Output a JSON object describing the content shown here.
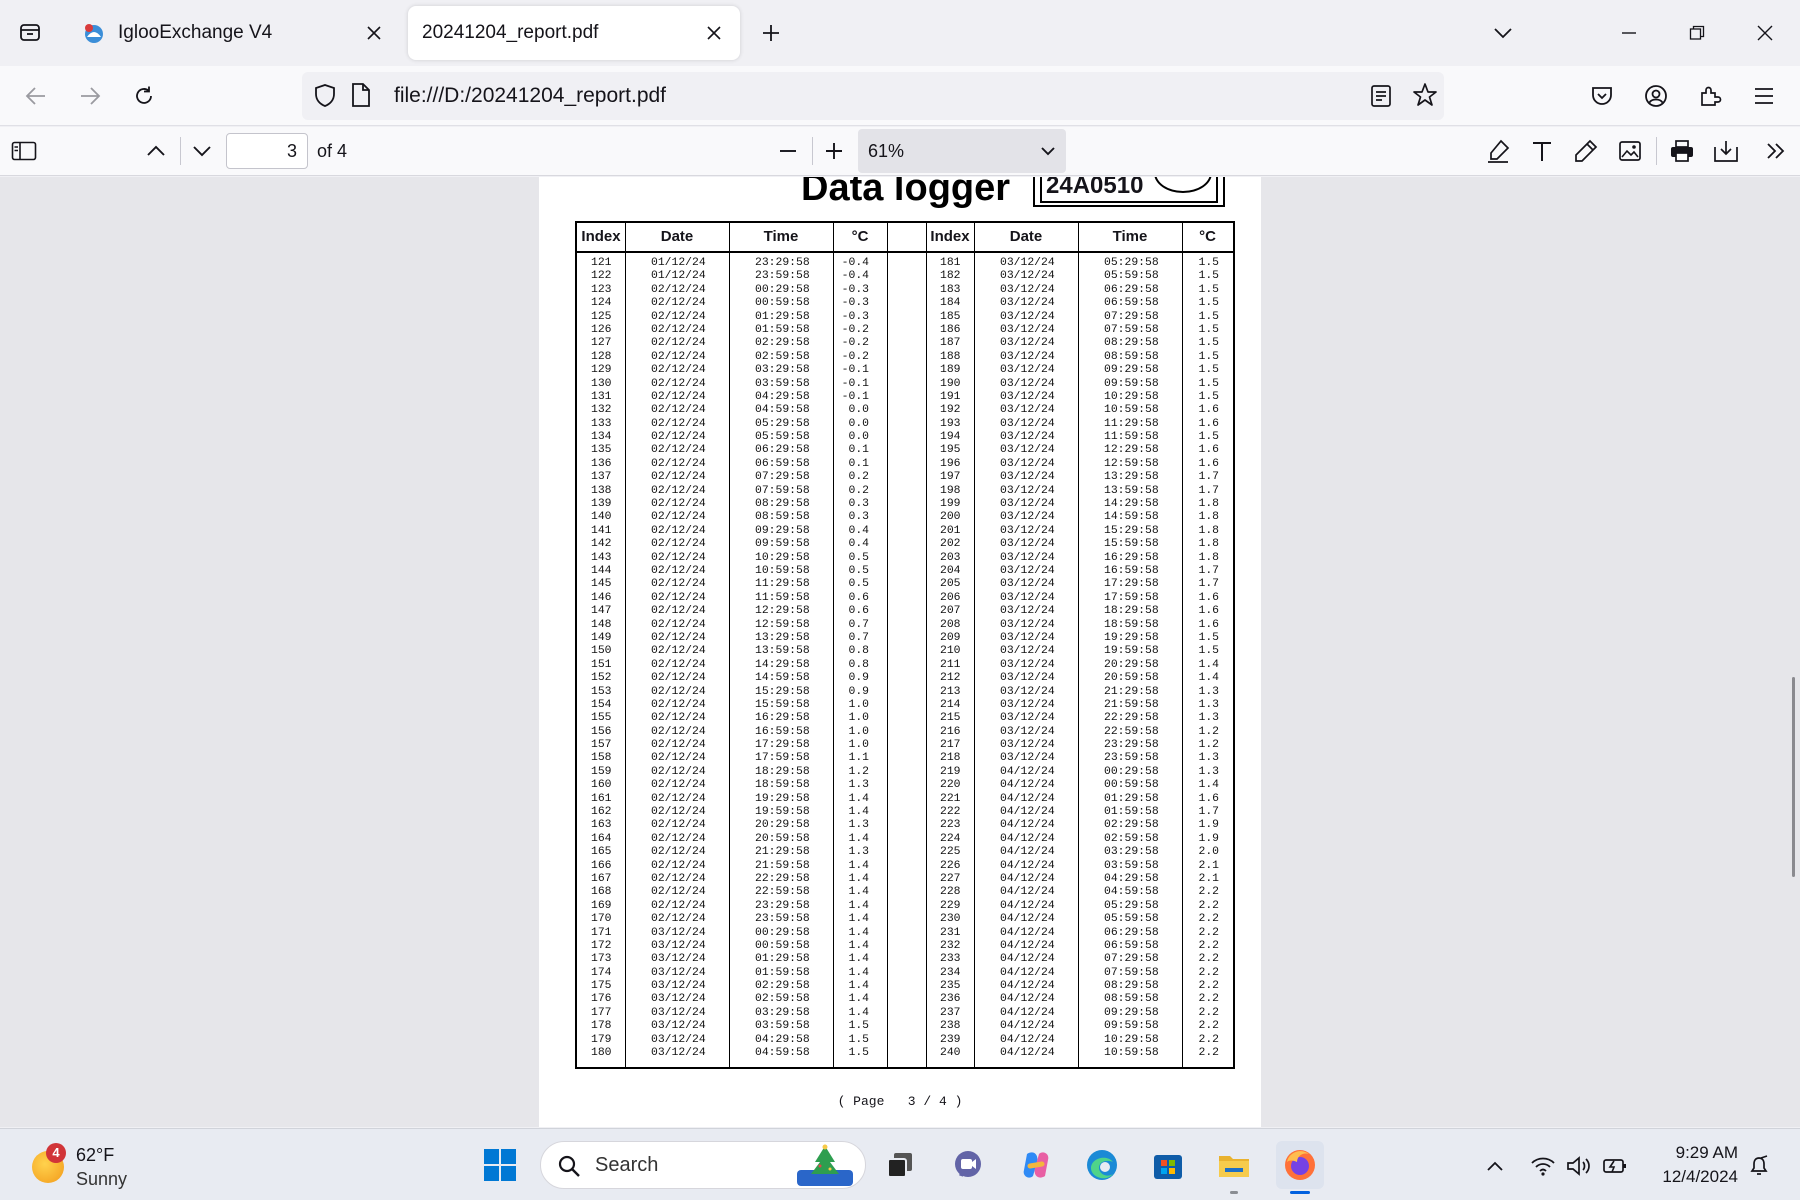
{
  "browser": {
    "tabs": [
      {
        "label": "IglooExchange V4",
        "active": false
      },
      {
        "label": "20241204_report.pdf",
        "active": true
      }
    ],
    "url": "file:///D:/20241204_report.pdf"
  },
  "pdf_toolbar": {
    "page_current": "3",
    "page_count_label": "of 4",
    "zoom": "61%"
  },
  "document": {
    "title": "Data logger",
    "serial": "24A0510",
    "headers": [
      "Index",
      "Date",
      "Time",
      "°C",
      "Index",
      "Date",
      "Time",
      "°C"
    ],
    "left": {
      "index": [
        "121",
        "122",
        "123",
        "124",
        "125",
        "126",
        "127",
        "128",
        "129",
        "130",
        "131",
        "132",
        "133",
        "134",
        "135",
        "136",
        "137",
        "138",
        "139",
        "140",
        "141",
        "142",
        "143",
        "144",
        "145",
        "146",
        "147",
        "148",
        "149",
        "150",
        "151",
        "152",
        "153",
        "154",
        "155",
        "156",
        "157",
        "158",
        "159",
        "160",
        "161",
        "162",
        "163",
        "164",
        "165",
        "166",
        "167",
        "168",
        "169",
        "170",
        "171",
        "172",
        "173",
        "174",
        "175",
        "176",
        "177",
        "178",
        "179",
        "180"
      ],
      "date": [
        "01/12/24",
        "01/12/24",
        "02/12/24",
        "02/12/24",
        "02/12/24",
        "02/12/24",
        "02/12/24",
        "02/12/24",
        "02/12/24",
        "02/12/24",
        "02/12/24",
        "02/12/24",
        "02/12/24",
        "02/12/24",
        "02/12/24",
        "02/12/24",
        "02/12/24",
        "02/12/24",
        "02/12/24",
        "02/12/24",
        "02/12/24",
        "02/12/24",
        "02/12/24",
        "02/12/24",
        "02/12/24",
        "02/12/24",
        "02/12/24",
        "02/12/24",
        "02/12/24",
        "02/12/24",
        "02/12/24",
        "02/12/24",
        "02/12/24",
        "02/12/24",
        "02/12/24",
        "02/12/24",
        "02/12/24",
        "02/12/24",
        "02/12/24",
        "02/12/24",
        "02/12/24",
        "02/12/24",
        "02/12/24",
        "02/12/24",
        "02/12/24",
        "02/12/24",
        "02/12/24",
        "02/12/24",
        "02/12/24",
        "02/12/24",
        "03/12/24",
        "03/12/24",
        "03/12/24",
        "03/12/24",
        "03/12/24",
        "03/12/24",
        "03/12/24",
        "03/12/24",
        "03/12/24",
        "03/12/24"
      ],
      "time": [
        "23:29:58",
        "23:59:58",
        "00:29:58",
        "00:59:58",
        "01:29:58",
        "01:59:58",
        "02:29:58",
        "02:59:58",
        "03:29:58",
        "03:59:58",
        "04:29:58",
        "04:59:58",
        "05:29:58",
        "05:59:58",
        "06:29:58",
        "06:59:58",
        "07:29:58",
        "07:59:58",
        "08:29:58",
        "08:59:58",
        "09:29:58",
        "09:59:58",
        "10:29:58",
        "10:59:58",
        "11:29:58",
        "11:59:58",
        "12:29:58",
        "12:59:58",
        "13:29:58",
        "13:59:58",
        "14:29:58",
        "14:59:58",
        "15:29:58",
        "15:59:58",
        "16:29:58",
        "16:59:58",
        "17:29:58",
        "17:59:58",
        "18:29:58",
        "18:59:58",
        "19:29:58",
        "19:59:58",
        "20:29:58",
        "20:59:58",
        "21:29:58",
        "21:59:58",
        "22:29:58",
        "22:59:58",
        "23:29:58",
        "23:59:58",
        "00:29:58",
        "00:59:58",
        "01:29:58",
        "01:59:58",
        "02:29:58",
        "02:59:58",
        "03:29:58",
        "03:59:58",
        "04:29:58",
        "04:59:58"
      ],
      "temp": [
        "-0.4",
        "-0.4",
        "-0.3",
        "-0.3",
        "-0.3",
        "-0.2",
        "-0.2",
        "-0.2",
        "-0.1",
        "-0.1",
        "-0.1",
        "0.0",
        "0.0",
        "0.0",
        "0.1",
        "0.1",
        "0.2",
        "0.2",
        "0.3",
        "0.3",
        "0.4",
        "0.4",
        "0.5",
        "0.5",
        "0.5",
        "0.6",
        "0.6",
        "0.7",
        "0.7",
        "0.8",
        "0.8",
        "0.9",
        "0.9",
        "1.0",
        "1.0",
        "1.0",
        "1.0",
        "1.1",
        "1.2",
        "1.3",
        "1.4",
        "1.4",
        "1.3",
        "1.4",
        "1.3",
        "1.4",
        "1.4",
        "1.4",
        "1.4",
        "1.4",
        "1.4",
        "1.4",
        "1.4",
        "1.4",
        "1.4",
        "1.4",
        "1.4",
        "1.5",
        "1.5",
        "1.5"
      ]
    },
    "right": {
      "index": [
        "181",
        "182",
        "183",
        "184",
        "185",
        "186",
        "187",
        "188",
        "189",
        "190",
        "191",
        "192",
        "193",
        "194",
        "195",
        "196",
        "197",
        "198",
        "199",
        "200",
        "201",
        "202",
        "203",
        "204",
        "205",
        "206",
        "207",
        "208",
        "209",
        "210",
        "211",
        "212",
        "213",
        "214",
        "215",
        "216",
        "217",
        "218",
        "219",
        "220",
        "221",
        "222",
        "223",
        "224",
        "225",
        "226",
        "227",
        "228",
        "229",
        "230",
        "231",
        "232",
        "233",
        "234",
        "235",
        "236",
        "237",
        "238",
        "239",
        "240"
      ],
      "date": [
        "03/12/24",
        "03/12/24",
        "03/12/24",
        "03/12/24",
        "03/12/24",
        "03/12/24",
        "03/12/24",
        "03/12/24",
        "03/12/24",
        "03/12/24",
        "03/12/24",
        "03/12/24",
        "03/12/24",
        "03/12/24",
        "03/12/24",
        "03/12/24",
        "03/12/24",
        "03/12/24",
        "03/12/24",
        "03/12/24",
        "03/12/24",
        "03/12/24",
        "03/12/24",
        "03/12/24",
        "03/12/24",
        "03/12/24",
        "03/12/24",
        "03/12/24",
        "03/12/24",
        "03/12/24",
        "03/12/24",
        "03/12/24",
        "03/12/24",
        "03/12/24",
        "03/12/24",
        "03/12/24",
        "03/12/24",
        "03/12/24",
        "04/12/24",
        "04/12/24",
        "04/12/24",
        "04/12/24",
        "04/12/24",
        "04/12/24",
        "04/12/24",
        "04/12/24",
        "04/12/24",
        "04/12/24",
        "04/12/24",
        "04/12/24",
        "04/12/24",
        "04/12/24",
        "04/12/24",
        "04/12/24",
        "04/12/24",
        "04/12/24",
        "04/12/24",
        "04/12/24",
        "04/12/24",
        "04/12/24"
      ],
      "time": [
        "05:29:58",
        "05:59:58",
        "06:29:58",
        "06:59:58",
        "07:29:58",
        "07:59:58",
        "08:29:58",
        "08:59:58",
        "09:29:58",
        "09:59:58",
        "10:29:58",
        "10:59:58",
        "11:29:58",
        "11:59:58",
        "12:29:58",
        "12:59:58",
        "13:29:58",
        "13:59:58",
        "14:29:58",
        "14:59:58",
        "15:29:58",
        "15:59:58",
        "16:29:58",
        "16:59:58",
        "17:29:58",
        "17:59:58",
        "18:29:58",
        "18:59:58",
        "19:29:58",
        "19:59:58",
        "20:29:58",
        "20:59:58",
        "21:29:58",
        "21:59:58",
        "22:29:58",
        "22:59:58",
        "23:29:58",
        "23:59:58",
        "00:29:58",
        "00:59:58",
        "01:29:58",
        "01:59:58",
        "02:29:58",
        "02:59:58",
        "03:29:58",
        "03:59:58",
        "04:29:58",
        "04:59:58",
        "05:29:58",
        "05:59:58",
        "06:29:58",
        "06:59:58",
        "07:29:58",
        "07:59:58",
        "08:29:58",
        "08:59:58",
        "09:29:58",
        "09:59:58",
        "10:29:58",
        "10:59:58"
      ],
      "temp": [
        "1.5",
        "1.5",
        "1.5",
        "1.5",
        "1.5",
        "1.5",
        "1.5",
        "1.5",
        "1.5",
        "1.5",
        "1.5",
        "1.6",
        "1.6",
        "1.5",
        "1.6",
        "1.6",
        "1.7",
        "1.7",
        "1.8",
        "1.8",
        "1.8",
        "1.8",
        "1.8",
        "1.7",
        "1.7",
        "1.6",
        "1.6",
        "1.6",
        "1.5",
        "1.5",
        "1.4",
        "1.4",
        "1.3",
        "1.3",
        "1.3",
        "1.2",
        "1.2",
        "1.3",
        "1.3",
        "1.4",
        "1.6",
        "1.7",
        "1.9",
        "1.9",
        "2.0",
        "2.1",
        "2.1",
        "2.2",
        "2.2",
        "2.2",
        "2.2",
        "2.2",
        "2.2",
        "2.2",
        "2.2",
        "2.2",
        "2.2",
        "2.2",
        "2.2",
        "2.2"
      ]
    },
    "footer": "( Page   3 / 4 )"
  },
  "taskbar": {
    "weather_temp": "62°F",
    "weather_condition": "Sunny",
    "weather_badge": "4",
    "search_label": "Search",
    "time": "9:29 AM",
    "date": "12/4/2024"
  },
  "colors": {
    "accent": "#0060df",
    "firefox_orange": "#ff7139",
    "windows_blue": "#0078d4"
  }
}
